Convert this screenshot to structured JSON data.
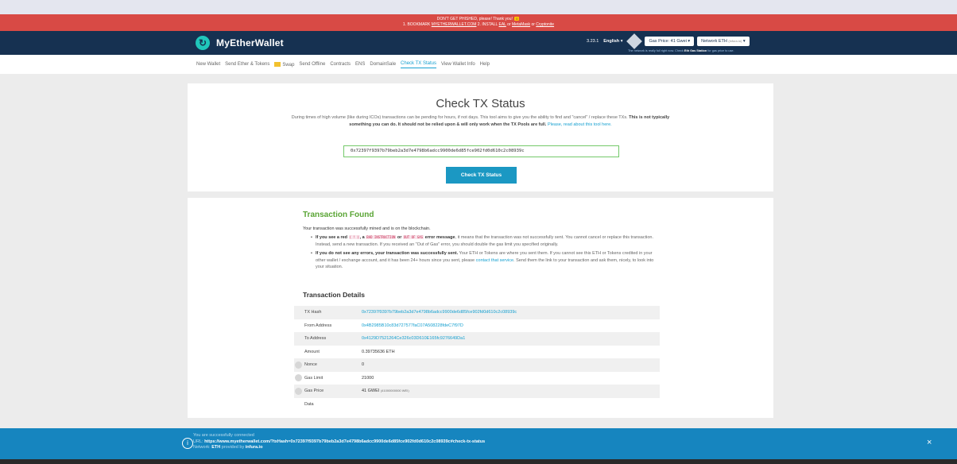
{
  "banner": {
    "line1": "DON'T GET PHISHED, please! Thank you!",
    "line2_prefix": "1. BOOKMARK ",
    "bookmark_link": "MYETHERWALLET.COM",
    "line2_mid": "    2. INSTALL ",
    "eal_link": "EAL",
    "or1": " or ",
    "metamask_link": "MetaMask",
    "or2": " or ",
    "cryptonite_link": "Cryptonite"
  },
  "header": {
    "brand": "MyEtherWallet",
    "version": "3.23.1",
    "language": "English",
    "gas_price": "Gas Price: 41 Gwei",
    "network_label": "Network ETH",
    "network_provider": "(infura.io)",
    "network_note": "The network is really full right now. Check ",
    "network_note_link": "Eth Gas Station",
    "network_note_end": " for gas price to use."
  },
  "nav": {
    "items": [
      "New Wallet",
      "Send Ether & Tokens",
      "Swap",
      "Send Offline",
      "Contracts",
      "ENS",
      "DomainSale",
      "Check TX Status",
      "View Wallet Info",
      "Help"
    ]
  },
  "check": {
    "title": "Check TX Status",
    "desc_plain": "During times of high volume (like during ICOs) transactions can be pending for hours, if not days. This tool aims to give you the ability to find and \"cancel\" / replace these TXs.",
    "desc_bold": " This is not typically something you can do. It should not be relied upon & will only work when the TX Pools are full.",
    "desc_link": " Please, read about this tool here.",
    "input_value": "0x72397f9397b79beb2a3d7e4798b6adcc9900de6d85fce902fd0d610c2c08939c",
    "button": "Check TX Status"
  },
  "result": {
    "title": "Transaction Found",
    "subtitle": "Your transaction was successfully mined and is on the blockchain.",
    "b1_bold1": "If you see a red ",
    "b1_code1": "( ! )",
    "b1_bold2": ", a ",
    "b1_code2": "BAD INSTRUCTION",
    "b1_bold3": " or ",
    "b1_code3": "OUT OF GAS",
    "b1_bold4": " error message",
    "b1_rest": ", it means that the transaction was not successfully sent. You cannot cancel or replace this transaction. Instead, send a new transaction. If you received an \"Out of Gas\" error, you should double the gas limit you specified originally.",
    "b2_bold": "If you do not see any errors, your transaction was successfully sent.",
    "b2_rest1": " Your ETH or Tokens are where you sent them. If you cannot see this ETH or Tokens credited in your other wallet / exchange account, and it has been 24+ hours since you sent, please ",
    "b2_link": "contact that service",
    "b2_rest2": ". Send them the link to your transaction and ask them, nicely, to look into your situation.",
    "details_title": "Transaction Details",
    "rows": {
      "hash": {
        "label": "TX Hash",
        "value": "0x72397f9397b79beb2a3d7e4798b6adcc9900de6d85fce902fd0d610c2c08939c"
      },
      "from": {
        "label": "From Address",
        "value": "0x4B2985B10c83d727577faC07A508228fdeC7f97D"
      },
      "to": {
        "label": "To Address",
        "value": "0x4129D7521264Ce326c03D610E165fc9276649Da1"
      },
      "amount": {
        "label": "Amount",
        "value": "0.39735636 ETH"
      },
      "nonce": {
        "label": "Nonce",
        "value": "0"
      },
      "gas_limit": {
        "label": "Gas Limit",
        "value": "21000"
      },
      "gas_price": {
        "label": "Gas Price",
        "value": "41 GWEI",
        "value_small": "(41000000000 WEI)"
      },
      "data": {
        "label": "Data",
        "value": ""
      }
    }
  },
  "footer": {
    "line1": "You are successfully connected",
    "url_label": "URL: ",
    "url": "https://www.myetherwallet.com/?txHash=0x72397f9397b79beb2a3d7e4798b6adcc9900de6d85fce902fd0d610c2c08939c#check-tx-status",
    "network_label": "Network: ",
    "network": "ETH",
    "provided": " provided by ",
    "provider": "infura.io",
    "close": "×"
  },
  "colors": {
    "banner_red": "#d84a45",
    "header_navy": "#163151",
    "accent_blue": "#16a0d0",
    "success_green": "#5aa535",
    "footer_blue": "#1685bf"
  }
}
